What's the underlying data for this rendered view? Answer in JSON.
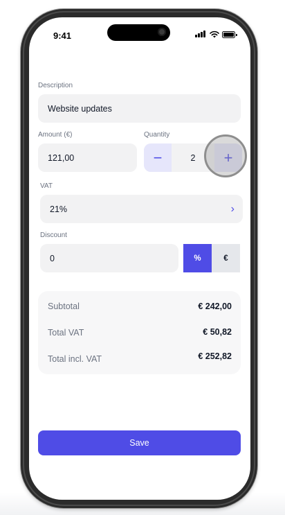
{
  "status_bar": {
    "time": "9:41"
  },
  "form": {
    "description": {
      "label": "Description",
      "value": "Website updates"
    },
    "amount": {
      "label": "Amount (€)",
      "value": "121,00"
    },
    "quantity": {
      "label": "Quantity",
      "value": "2",
      "decrement_icon": "minus-icon",
      "increment_icon": "plus-icon"
    },
    "vat": {
      "label": "VAT",
      "value": "21%",
      "icon": "chevron-right-icon"
    },
    "discount": {
      "label": "Discount",
      "value": "0",
      "percent_label": "%",
      "euro_label": "€",
      "selected": "%"
    }
  },
  "summary": {
    "subtotal_label": "Subtotal",
    "subtotal_value": "€ 242,00",
    "vat_label": "Total VAT",
    "vat_value": "€ 50,82",
    "total_label": "Total incl. VAT",
    "total_value": "€ 252,82"
  },
  "actions": {
    "save_label": "Save"
  },
  "colors": {
    "accent": "#4f4ce6",
    "accent_light": "#e6e6fb",
    "field_bg": "#f2f2f3",
    "frame": "#2b2b2b"
  }
}
